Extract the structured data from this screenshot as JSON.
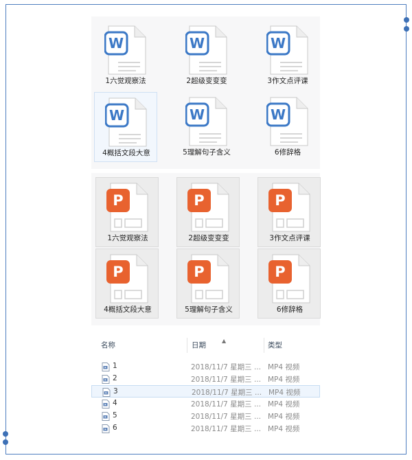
{
  "word_files": [
    {
      "label": "1六觉观察法",
      "icon_letter": "W"
    },
    {
      "label": "2超级变变变",
      "icon_letter": "W"
    },
    {
      "label": "3作文点评课",
      "icon_letter": "W"
    },
    {
      "label": "4概括文段大意",
      "icon_letter": "W"
    },
    {
      "label": "5理解句子含义",
      "icon_letter": "W"
    },
    {
      "label": "6修辞格",
      "icon_letter": "W"
    }
  ],
  "ppt_files": [
    {
      "label": "1六觉观察法",
      "icon_letter": "P"
    },
    {
      "label": "2超级变变变",
      "icon_letter": "P"
    },
    {
      "label": "3作文点评课",
      "icon_letter": "P"
    },
    {
      "label": "4概括文段大意",
      "icon_letter": "P"
    },
    {
      "label": "5理解句子含义",
      "icon_letter": "P"
    },
    {
      "label": "6修辞格",
      "icon_letter": "P"
    }
  ],
  "list": {
    "columns": {
      "name": "名称",
      "date": "日期",
      "type": "类型"
    },
    "rows": [
      {
        "name": "1",
        "date": "2018/11/7 星期三 ...",
        "type": "MP4 视频"
      },
      {
        "name": "2",
        "date": "2018/11/7 星期三 ...",
        "type": "MP4 视频"
      },
      {
        "name": "3",
        "date": "2018/11/7 星期三 ...",
        "type": "MP4 视频"
      },
      {
        "name": "4",
        "date": "2018/11/7 星期三 ...",
        "type": "MP4 视频"
      },
      {
        "name": "5",
        "date": "2018/11/7 星期三 ...",
        "type": "MP4 视频"
      },
      {
        "name": "6",
        "date": "2018/11/7 星期三 ...",
        "type": "MP4 视频"
      }
    ]
  },
  "colors": {
    "word_blue": "#3b78c6",
    "ppt_orange": "#e8622f",
    "frame_blue": "#4f7fbf"
  }
}
